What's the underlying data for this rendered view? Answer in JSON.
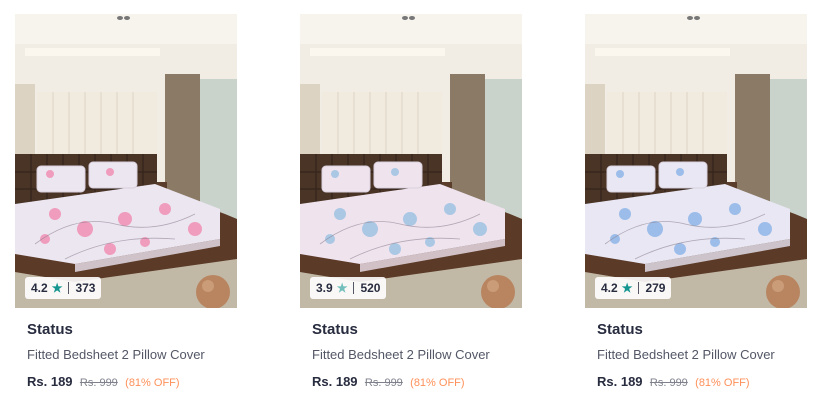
{
  "products": [
    {
      "brand": "Status",
      "title": "Fitted Bedsheet 2 Pillow Cover",
      "rating": "4.2",
      "rating_count": "373",
      "price": "Rs. 189",
      "mrp": "Rs. 999",
      "discount": "(81% OFF)",
      "star_color": "#14958f",
      "sheet_color": "#ece6f1",
      "flower_color": "#f090b4"
    },
    {
      "brand": "Status",
      "title": "Fitted Bedsheet 2 Pillow Cover",
      "rating": "3.9",
      "rating_count": "520",
      "price": "Rs. 189",
      "mrp": "Rs. 999",
      "discount": "(81% OFF)",
      "star_color": "#72bfbc",
      "sheet_color": "#efe3ee",
      "flower_color": "#9fc3e3"
    },
    {
      "brand": "Status",
      "title": "Fitted Bedsheet 2 Pillow Cover",
      "rating": "4.2",
      "rating_count": "279",
      "price": "Rs. 189",
      "mrp": "Rs. 999",
      "discount": "(81% OFF)",
      "star_color": "#14958f",
      "sheet_color": "#e8e7f3",
      "flower_color": "#8fb6e8"
    }
  ]
}
